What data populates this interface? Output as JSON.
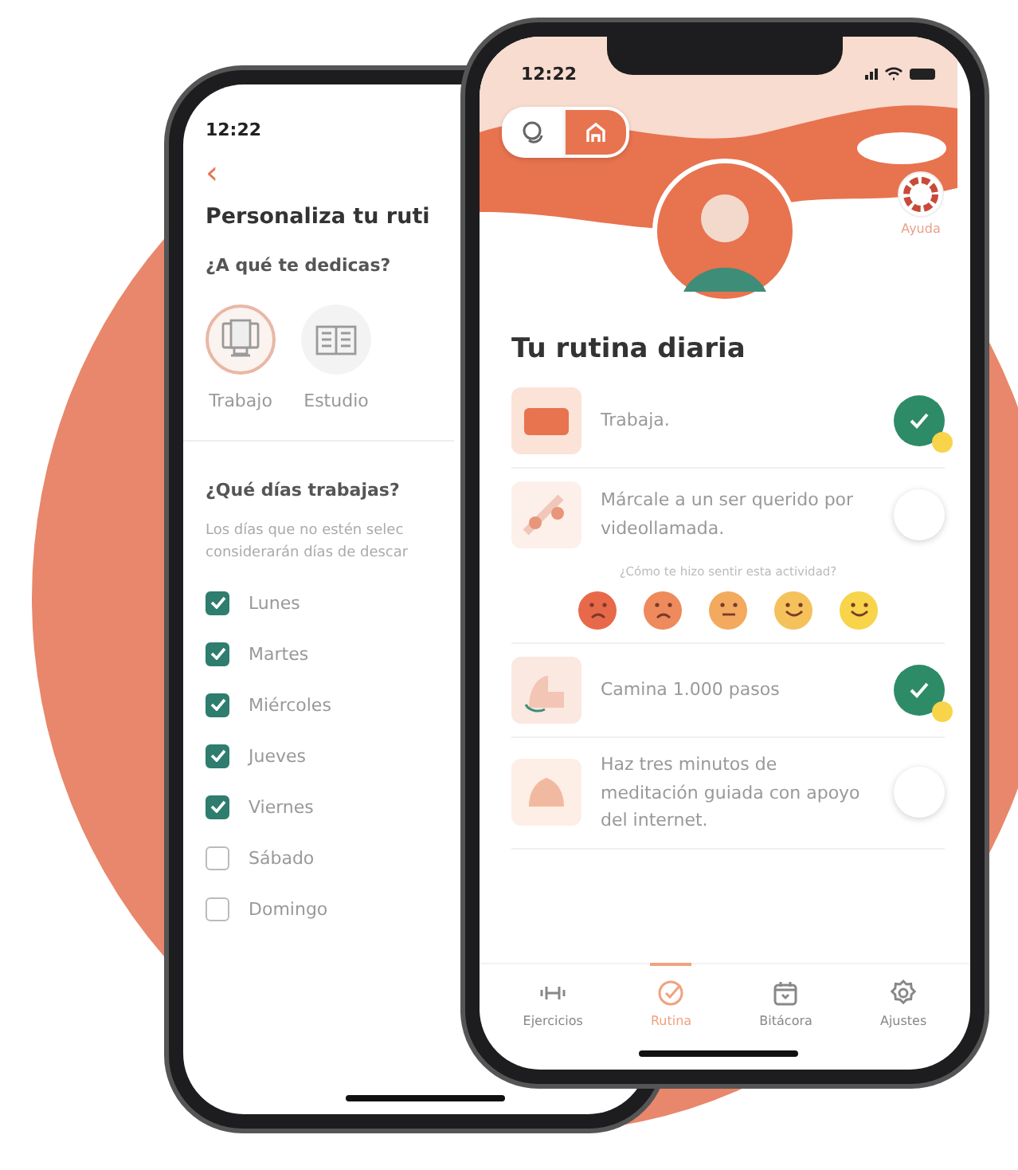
{
  "back_phone": {
    "time": "12:22",
    "back_label": "‹",
    "title": "Personaliza tu ruti",
    "question": "¿A qué te dedicas?",
    "occupations": [
      {
        "label": "Trabajo",
        "kind": "computer",
        "selected": true
      },
      {
        "label": "Estudio",
        "kind": "book",
        "selected": false
      }
    ],
    "days_question": "¿Qué días trabajas?",
    "note_lines": [
      "Los días que no estén selec",
      "considerarán días de descar"
    ],
    "days": [
      {
        "label": "Lunes",
        "checked": true
      },
      {
        "label": "Martes",
        "checked": true
      },
      {
        "label": "Miércoles",
        "checked": true
      },
      {
        "label": "Jueves",
        "checked": true
      },
      {
        "label": "Viernes",
        "checked": true
      },
      {
        "label": "Sábado",
        "checked": false
      },
      {
        "label": "Domingo",
        "checked": false
      }
    ]
  },
  "front_phone": {
    "time": "12:22",
    "toggle": [
      {
        "kind": "chat",
        "selected": false
      },
      {
        "kind": "home",
        "selected": true
      }
    ],
    "help_label": "Ayuda",
    "title": "Tu rutina diaria",
    "tasks": [
      {
        "text": "Trabaja.",
        "kind": "work",
        "done": true
      },
      {
        "text": "Márcale a un ser querido por videollamada.",
        "kind": "call",
        "done": false,
        "mood_prompt": "¿Cómo te hizo sentir esta actividad?",
        "moods": [
          {
            "color": "#e8694a"
          },
          {
            "color": "#ee8a5c"
          },
          {
            "color": "#f3aa5f"
          },
          {
            "color": "#f5c15a"
          },
          {
            "color": "#f7d44a"
          }
        ]
      },
      {
        "text": "Camina 1.000 pasos",
        "kind": "walk",
        "done": true
      },
      {
        "text": "Haz tres minutos de meditación guiada con apoyo del internet.",
        "kind": "meditate",
        "done": false
      }
    ],
    "nav": [
      {
        "label": "Ejercicios",
        "kind": "dumbbell",
        "selected": false
      },
      {
        "label": "Rutina",
        "kind": "check",
        "selected": true
      },
      {
        "label": "Bitácora",
        "kind": "calendar",
        "selected": false
      },
      {
        "label": "Ajustes",
        "kind": "gear",
        "selected": false
      }
    ]
  }
}
